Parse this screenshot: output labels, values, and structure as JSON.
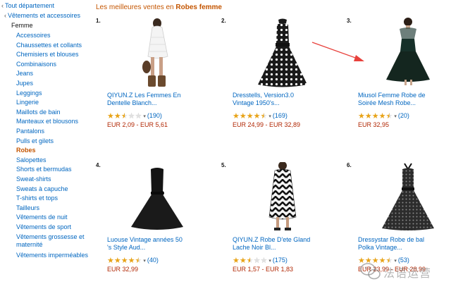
{
  "sidebar": {
    "all_departments": "Tout département",
    "category": "Vêtements et accessoires",
    "subcategory": "Femme",
    "items": [
      {
        "label": "Accessoires"
      },
      {
        "label": "Chaussettes et collants"
      },
      {
        "label": "Chemisiers et blouses"
      },
      {
        "label": "Combinaisons"
      },
      {
        "label": "Jeans"
      },
      {
        "label": "Jupes"
      },
      {
        "label": "Leggings"
      },
      {
        "label": "Lingerie"
      },
      {
        "label": "Maillots de bain"
      },
      {
        "label": "Manteaux et blousons"
      },
      {
        "label": "Pantalons"
      },
      {
        "label": "Pulls et gilets"
      },
      {
        "label": "Robes",
        "active": true
      },
      {
        "label": "Salopettes"
      },
      {
        "label": "Shorts et bermudas"
      },
      {
        "label": "Sweat-shirts"
      },
      {
        "label": "Sweats à capuche"
      },
      {
        "label": "T-shirts et tops"
      },
      {
        "label": "Tailleurs"
      },
      {
        "label": "Vêtements de nuit"
      },
      {
        "label": "Vêtements de sport"
      },
      {
        "label": "Vêtements grossesse et maternité",
        "lines": [
          "Vêtements grossesse et",
          "maternité"
        ]
      },
      {
        "label": "Vêtements imperméables"
      }
    ]
  },
  "heading": {
    "prefix": "Les meilleures ventes en ",
    "category": "Robes femme"
  },
  "products": [
    {
      "rank": "1.",
      "title_lines": [
        "QIYUN.Z Les Femmes En",
        "Dentelle Blanch..."
      ],
      "rating": 2.5,
      "reviews": "(190)",
      "price": "EUR 2,09 - EUR 5,61",
      "image": "white-lace-dress"
    },
    {
      "rank": "2.",
      "title_lines": [
        "Dresstells, Version3.0",
        "Vintage 1950's..."
      ],
      "rating": 4.5,
      "reviews": "(169)",
      "price": "EUR 24,99 - EUR 32,89",
      "image": "black-white-polka-dot-dress"
    },
    {
      "rank": "3.",
      "title_lines": [
        "Miusol Femme Robe de",
        "Soirée Mesh Robe..."
      ],
      "rating": 4.5,
      "reviews": "(20)",
      "price": "EUR 32,95",
      "image": "dark-green-mesh-dress"
    },
    {
      "rank": "4.",
      "title_lines": [
        "Luouse Vintage années 50",
        "'s Style Aud..."
      ],
      "rating": 4.5,
      "reviews": "(40)",
      "price": "EUR 32,99",
      "image": "black-sleeveless-dress"
    },
    {
      "rank": "5.",
      "title_lines": [
        "QIYUN.Z Robe D'ete Gland",
        "Lache Noir Bl..."
      ],
      "rating": 2.5,
      "reviews": "(175)",
      "price": "EUR 1,57 - EUR 1,83",
      "image": "black-white-zigzag-dress"
    },
    {
      "rank": "6.",
      "title_lines": [
        "Dressystar Robe de bal",
        "Polka Vintage..."
      ],
      "rating": 4.5,
      "reviews": "(53)",
      "price": "EUR 23,99 - EUR 28,99",
      "image": "grey-polka-dot-halter-dress"
    }
  ],
  "watermark": {
    "text": "法语运营",
    "icon": "wechat-icon"
  },
  "colors": {
    "link": "#0066c0",
    "accent": "#c45500",
    "price": "#b12704",
    "star": "#e8a317",
    "arrow": "#e8413c"
  }
}
